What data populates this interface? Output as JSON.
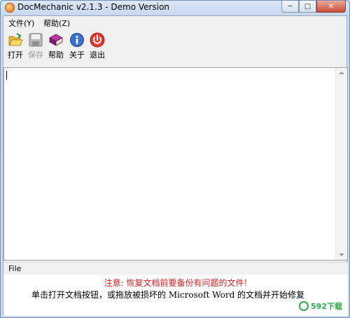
{
  "window": {
    "title": "DocMechanic v2.1.3 - Demo Version"
  },
  "caption": {
    "minimize": "─",
    "maximize": "□",
    "close": "✕"
  },
  "menu": [
    {
      "label": "文件(Y)"
    },
    {
      "label": "帮助(Z)"
    }
  ],
  "toolbar": [
    {
      "label": "打开",
      "icon": "open-folder-icon",
      "enabled": true
    },
    {
      "label": "保存",
      "icon": "save-disk-icon",
      "enabled": false
    },
    {
      "label": "帮助",
      "icon": "help-book-icon",
      "enabled": true
    },
    {
      "label": "关于",
      "icon": "info-icon",
      "enabled": true
    },
    {
      "label": "退出",
      "icon": "power-icon",
      "enabled": true
    }
  ],
  "file_panel": {
    "label": "File"
  },
  "notice": {
    "warning": "注意: 恢复文档前要备份有问题的文件!",
    "info": "单击打开文档按钮，或拖放被损坏的 Microsoft Word 的文档并开始修复"
  },
  "watermark": {
    "text": "592下载"
  },
  "colors": {
    "warning": "#cc1f1f",
    "accent": "#2aa84a",
    "titlebar": "#c6d8ef"
  }
}
